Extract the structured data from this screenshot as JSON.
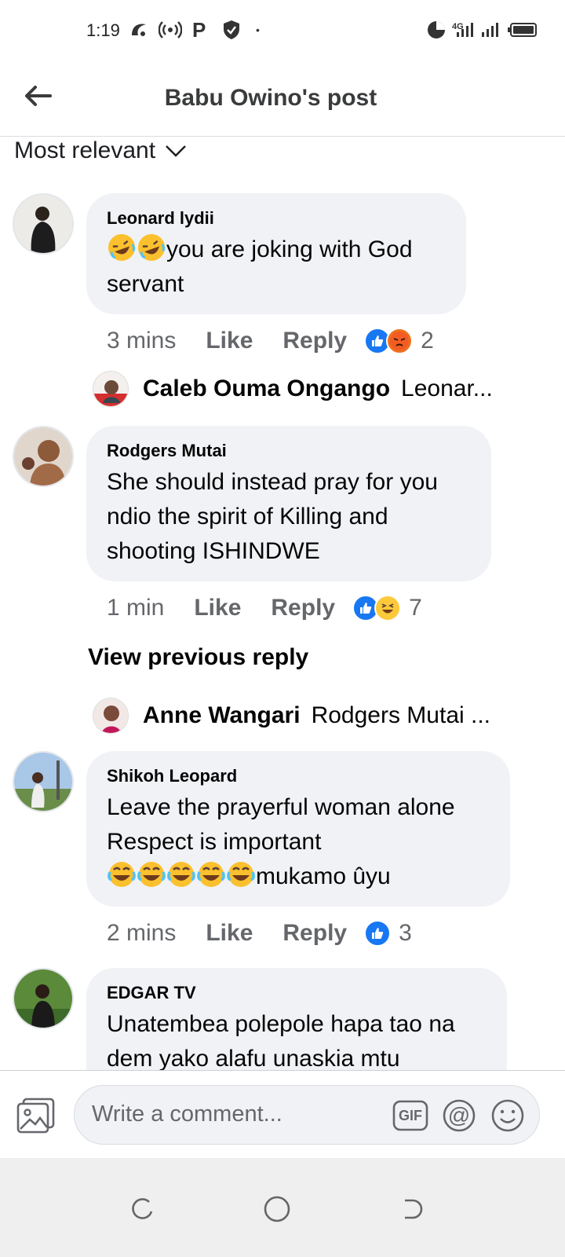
{
  "status_bar": {
    "time": "1:19",
    "p_icon": "P",
    "dot": "•",
    "network": "4G",
    "icons": [
      "nfc-icon",
      "hotspot-icon",
      "p-icon",
      "shield-icon",
      "data-saver-icon",
      "signal-icon",
      "battery-icon"
    ]
  },
  "header": {
    "title": "Babu Owino's post",
    "back_icon": "arrow-left-icon"
  },
  "sort": {
    "label": "Most relevant",
    "icon": "chevron-down-icon"
  },
  "comments": [
    {
      "name": "Leonard lydii",
      "text_after_emoji": "you are joking with God",
      "text_line2": "servant",
      "time": "3 mins",
      "like": "Like",
      "reply": "Reply",
      "reactions": [
        "like",
        "angry"
      ],
      "count": "2"
    },
    {
      "name": "Rodgers Mutai",
      "lines": [
        "She should instead pray for you",
        "ndio the spirit of Killing and",
        "shooting ISHINDWE"
      ],
      "time": "1 min",
      "like": "Like",
      "reply": "Reply",
      "reactions": [
        "like",
        "haha"
      ],
      "count": "7"
    },
    {
      "name": "Shikoh Leopard",
      "lines": [
        "Leave the prayerful woman alone",
        "Respect is important"
      ],
      "emoji_text": "mukamo ûyu",
      "time": "2 mins",
      "like": "Like",
      "reply": "Reply",
      "reactions": [
        "like"
      ],
      "count": "3"
    },
    {
      "name": "EDGAR TV",
      "lines": [
        "Unatembea polepole hapa tao na",
        "dem yako alafu unaskia mtu"
      ]
    }
  ],
  "replies": [
    {
      "name": "Caleb Ouma Ongango",
      "snippet": "Leonar..."
    },
    {
      "name": "Anne Wangari",
      "snippet": "Rodgers Mutai ..."
    }
  ],
  "view_previous": "View previous reply",
  "composer": {
    "placeholder": "Write a comment...",
    "gif_label": "GIF",
    "at_label": "@"
  },
  "colors": {
    "bubble": "#f0f2f5",
    "like_blue": "#1877f2",
    "muted": "#65676b"
  }
}
